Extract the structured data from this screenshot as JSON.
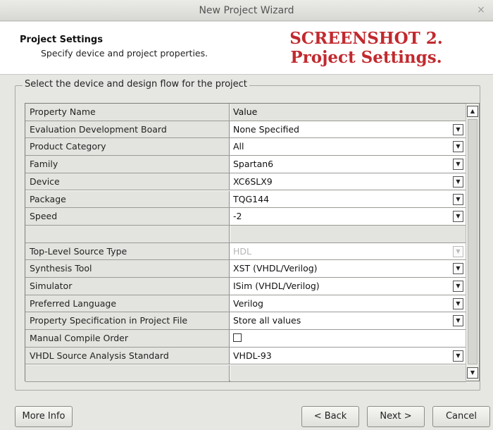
{
  "window": {
    "title": "New Project Wizard",
    "close_glyph": "×"
  },
  "header": {
    "title": "Project Settings",
    "subtitle": "Specify device and project properties.",
    "overlay_line1": "SCREENSHOT 2.",
    "overlay_line2": "Project Settings.",
    "overlay_color": "#c1292e"
  },
  "group": {
    "legend": "Select the device and design flow for the project"
  },
  "table": {
    "columns": [
      "Property Name",
      "Value"
    ],
    "rows": [
      {
        "prop": "Evaluation Development Board",
        "value": "None Specified",
        "control": "dropdown"
      },
      {
        "prop": "Product Category",
        "value": "All",
        "control": "dropdown"
      },
      {
        "prop": "Family",
        "value": "Spartan6",
        "control": "dropdown"
      },
      {
        "prop": "Device",
        "value": "XC6SLX9",
        "control": "dropdown"
      },
      {
        "prop": "Package",
        "value": "TQG144",
        "control": "dropdown"
      },
      {
        "prop": "Speed",
        "value": "-2",
        "control": "dropdown"
      },
      {
        "prop": "",
        "value": "",
        "control": "none"
      },
      {
        "prop": "Top-Level Source Type",
        "value": "HDL",
        "control": "dropdown-disabled"
      },
      {
        "prop": "Synthesis Tool",
        "value": "XST (VHDL/Verilog)",
        "control": "dropdown"
      },
      {
        "prop": "Simulator",
        "value": "ISim (VHDL/Verilog)",
        "control": "dropdown"
      },
      {
        "prop": "Preferred Language",
        "value": "Verilog",
        "control": "dropdown"
      },
      {
        "prop": "Property Specification in Project File",
        "value": "Store all values",
        "control": "dropdown"
      },
      {
        "prop": "Manual Compile Order",
        "value": "",
        "control": "checkbox",
        "checked": false
      },
      {
        "prop": "VHDL Source Analysis Standard",
        "value": "VHDL-93",
        "control": "dropdown"
      },
      {
        "prop": "",
        "value": "",
        "control": "none"
      }
    ],
    "dropdown_glyph": "▼",
    "scroll_up_glyph": "▲",
    "scroll_down_glyph": "▼"
  },
  "buttons": {
    "more_info": "More Info",
    "back": "< Back",
    "next": "Next >",
    "cancel": "Cancel"
  }
}
